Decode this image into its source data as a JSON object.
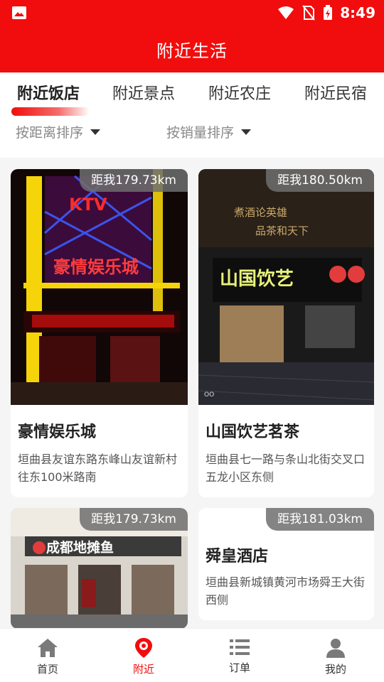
{
  "status_bar": {
    "time": "8:49"
  },
  "header": {
    "title": "附近生活"
  },
  "tabs": [
    {
      "label": "附近饭店",
      "active": true
    },
    {
      "label": "附近景点",
      "active": false
    },
    {
      "label": "附近农庄",
      "active": false
    },
    {
      "label": "附近民宿",
      "active": false
    }
  ],
  "sort": {
    "distance_label": "按距离排序",
    "sales_label": "按销量排序"
  },
  "cards": [
    {
      "distance": "距我179.73km",
      "name": "豪情娱乐城",
      "address": "垣曲县友谊东路东峰山友谊新村往东100米路南"
    },
    {
      "distance": "距我180.50km",
      "name": "山国饮艺茗茶",
      "address": "垣曲县七一路与条山北街交叉口五龙小区东侧"
    },
    {
      "distance": "距我179.73km",
      "name": "",
      "address": ""
    },
    {
      "distance": "距我181.03km",
      "name": "舜皇酒店",
      "address": "垣曲县新城镇黄河市场舜王大街西侧"
    }
  ],
  "bottom_nav": [
    {
      "label": "首页",
      "icon": "home-icon",
      "active": false
    },
    {
      "label": "附近",
      "icon": "location-pin-icon",
      "active": true
    },
    {
      "label": "订单",
      "icon": "list-icon",
      "active": false
    },
    {
      "label": "我的",
      "icon": "user-icon",
      "active": false
    }
  ],
  "colors": {
    "primary": "#f10d0d",
    "background": "#f5f5f5"
  }
}
